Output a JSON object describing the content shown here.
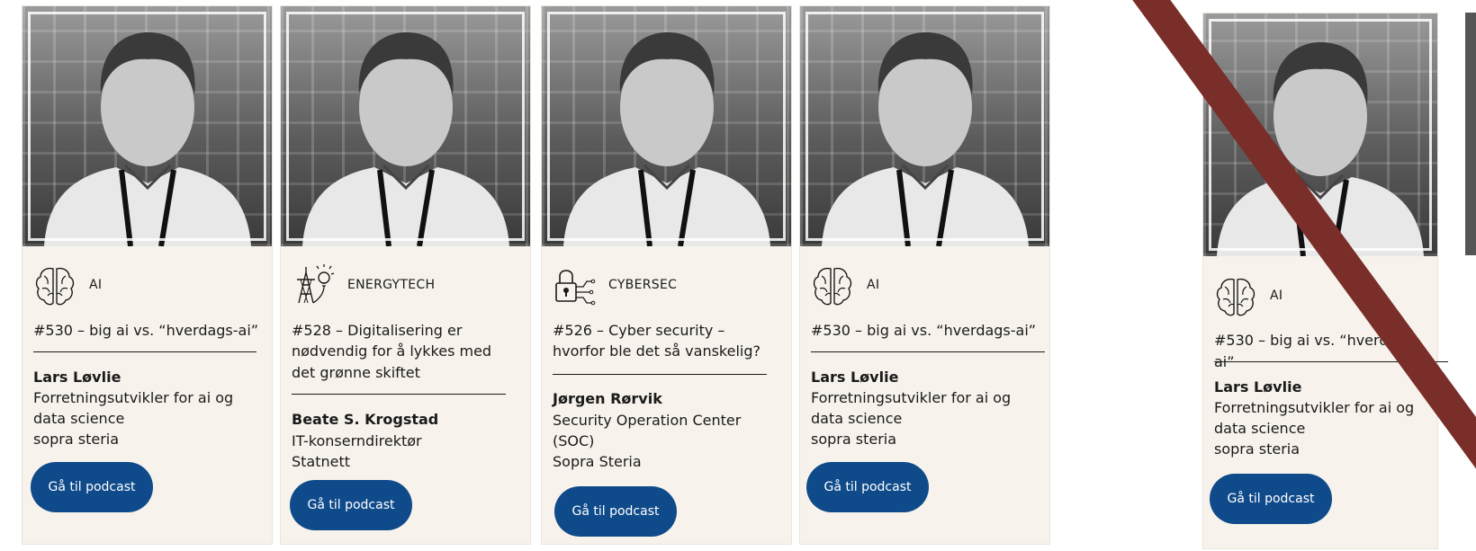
{
  "colors": {
    "card_bg": "#f7f3ec",
    "button": "#0f4a8a",
    "slash": "#7a2e2a"
  },
  "cards": [
    {
      "category": "AI",
      "category_icon": "brain-icon",
      "title": "#530 – big ai vs. “hverdags-ai”",
      "name": "Lars Løvlie",
      "role1": "Forretningsutvikler for ai og",
      "role2": "data science",
      "company": "sopra steria",
      "button": "Gå til podcast"
    },
    {
      "category": "ENERGYTECH",
      "category_icon": "power-tower-bulb-icon",
      "title_lines": [
        "#528 – Digitalisering er",
        "nødvendig for å lykkes med",
        "det grønne skiftet"
      ],
      "name": "Beate S. Krogstad",
      "role1": "IT-konserndirektør",
      "company": "Statnett",
      "button": "Gå til podcast"
    },
    {
      "category": "CYBERSEC",
      "category_icon": "padlock-circuit-icon",
      "title_lines": [
        "#526 – Cyber security –",
        "hvorfor ble det så vanskelig?"
      ],
      "name": "Jørgen Rørvik",
      "role1": "Security Operation Center",
      "role2": "(SOC)",
      "company": "Sopra Steria",
      "button": "Gå til podcast"
    },
    {
      "category": "AI",
      "category_icon": "brain-icon",
      "title": "#530 – big ai vs. “hverdags-ai”",
      "name": "Lars Løvlie",
      "role1": "Forretningsutvikler for ai og",
      "role2": "data science",
      "company": "sopra steria",
      "button": "Gå til podcast"
    },
    {
      "category": "AI",
      "category_icon": "brain-icon",
      "title": "#530 – big ai vs. “hverdags-ai”",
      "name": "Lars Løvlie",
      "role1": "Forretningsutvikler for ai og",
      "role2": "data science",
      "company": "sopra steria",
      "button": "Gå til podcast"
    }
  ]
}
